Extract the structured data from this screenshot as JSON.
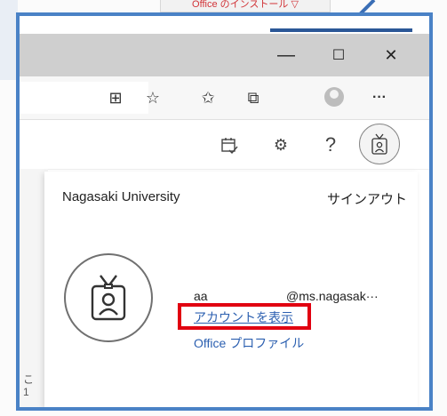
{
  "background": {
    "office_install_button": "Office のインストール ▽"
  },
  "window_controls": {
    "minimize": "—",
    "maximize": "☐",
    "close": "✕"
  },
  "toolbar": {
    "split_screen_icon": "⊞",
    "add_favorite_icon": "☆",
    "favorites_icon": "✩",
    "collections_icon": "⧉",
    "more_label": "···"
  },
  "app_header": {
    "calendar_icon": "📅",
    "settings_icon": "⚙",
    "help_label": "?"
  },
  "account_panel": {
    "organization": "Nagasaki University",
    "sign_out": "サインアウト",
    "user_name": "aa",
    "user_email": "@ms.nagasak···",
    "view_account": "アカウントを表示",
    "office_profile": "Office プロファイル"
  },
  "left_fragment": {
    "line1": "こ",
    "line2": "1"
  },
  "colors": {
    "frame_border": "#4a82c6",
    "highlight": "#e10010",
    "link": "#2b5fb0"
  }
}
